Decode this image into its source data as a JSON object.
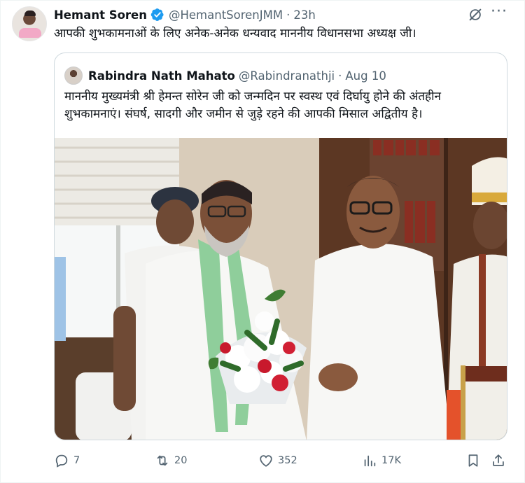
{
  "author": {
    "name": "Hemant Soren",
    "handle": "@HemantSorenJMM",
    "time": "23h",
    "text": "आपकी शुभकामनाओं के लिए अनेक-अनेक धन्यवाद माननीय विधानसभा अध्यक्ष जी।"
  },
  "quoted": {
    "name": "Rabindra Nath Mahato",
    "handle": "@Rabindranathji",
    "date": "Aug 10",
    "text_line1": "माननीय मुख्यमंत्री श्री हेमन्त सोरेन जी को जन्मदिन पर स्वस्थ एवं दिर्घायु होने की अंतहीन",
    "text_line2": "शुभकामनाएं। संघर्ष, सादगी और जमीन से जुड़े रहने की आपकी मिसाल अद्वितीय है।"
  },
  "metrics": {
    "replies": "7",
    "reposts": "20",
    "likes": "352",
    "views": "17K"
  },
  "icons": {
    "verified": "verified-badge-icon",
    "grok": "grok-icon",
    "more": "more-icon",
    "reply": "reply-icon",
    "repost": "repost-icon",
    "like": "heart-icon",
    "views": "views-icon",
    "bookmark": "bookmark-icon",
    "share": "share-icon"
  },
  "colors": {
    "verified": "#1d9bf0",
    "muted": "#536471",
    "text": "#0f1419",
    "border": "#cfd9de"
  }
}
